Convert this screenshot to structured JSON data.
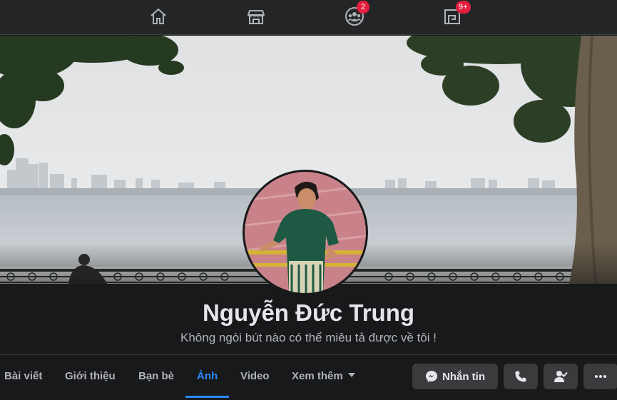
{
  "nav": {
    "items": [
      {
        "icon": "home-icon"
      },
      {
        "icon": "marketplace-icon"
      },
      {
        "icon": "groups-icon",
        "badge": "2"
      },
      {
        "icon": "gaming-icon",
        "badge": "9+"
      }
    ]
  },
  "profile": {
    "name": "Nguyễn Đức Trung",
    "bio": "Không ngòi bút nào có thể miêu tả được về tôi !"
  },
  "tabs": [
    "Bài viết",
    "Giới thiệu",
    "Bạn bè",
    "Ảnh",
    "Video",
    "Xem thêm"
  ],
  "active_tab": "Ảnh",
  "actions": {
    "message_label": "Nhắn tin"
  },
  "colors": {
    "accent": "#2d88ff",
    "badge": "#e41e3f",
    "background": "#18191a"
  }
}
